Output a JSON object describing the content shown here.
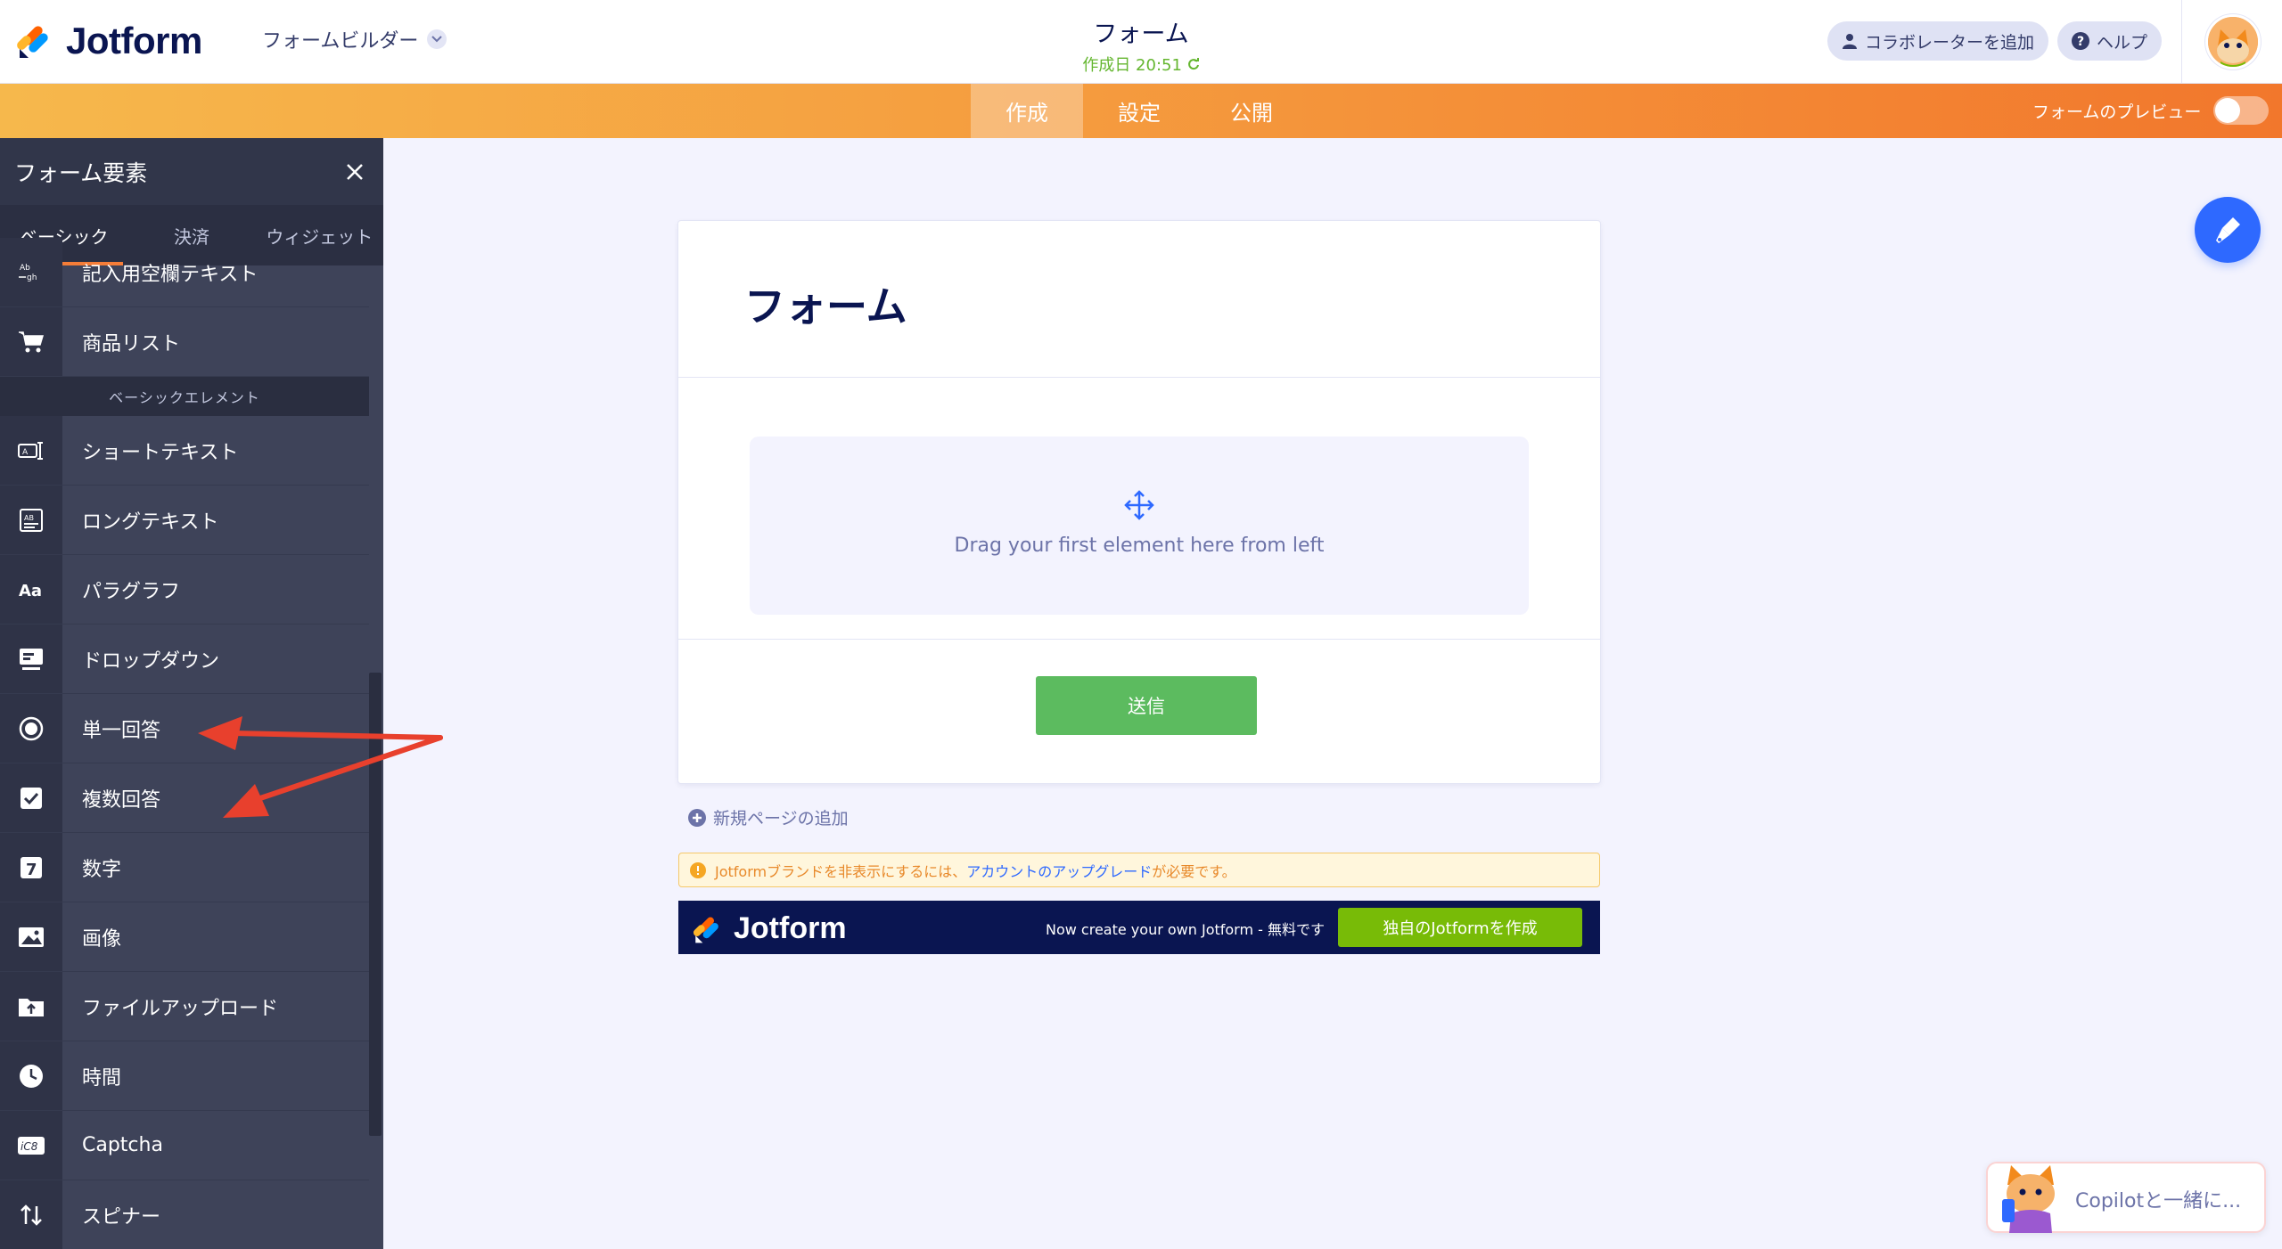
{
  "header": {
    "logo_text": "Jotform",
    "builder_label": "フォームビルダー",
    "form_title": "フォーム",
    "created_label": "作成日 20:51",
    "collab_button": "コラボレーターを追加",
    "help_button": "ヘルプ"
  },
  "nav": {
    "tabs": [
      {
        "label": "作成",
        "active": true
      },
      {
        "label": "設定",
        "active": false
      },
      {
        "label": "公開",
        "active": false
      }
    ],
    "preview_label": "フォームのプレビュー"
  },
  "sidebar": {
    "title": "フォーム要素",
    "tabs": [
      "ベーシック",
      "決済",
      "ウィジェット"
    ],
    "top_items": [
      {
        "label": "記入用空欄テキスト",
        "icon": "fill-blank-icon"
      },
      {
        "label": "商品リスト",
        "icon": "cart-icon"
      }
    ],
    "section_label": "ベーシックエレメント",
    "items": [
      {
        "label": "ショートテキスト",
        "icon": "short-text-icon"
      },
      {
        "label": "ロングテキスト",
        "icon": "long-text-icon"
      },
      {
        "label": "パラグラフ",
        "icon": "paragraph-icon"
      },
      {
        "label": "ドロップダウン",
        "icon": "dropdown-icon"
      },
      {
        "label": "単一回答",
        "icon": "radio-icon"
      },
      {
        "label": "複数回答",
        "icon": "checkbox-icon"
      },
      {
        "label": "数字",
        "icon": "number-icon"
      },
      {
        "label": "画像",
        "icon": "image-icon"
      },
      {
        "label": "ファイルアップロード",
        "icon": "upload-icon"
      },
      {
        "label": "時間",
        "icon": "clock-icon"
      },
      {
        "label": "Captcha",
        "icon": "captcha-icon"
      },
      {
        "label": "スピナー",
        "icon": "spinner-icon"
      }
    ]
  },
  "form": {
    "heading": "フォーム",
    "drop_hint": "Drag your first element here from left",
    "submit_label": "送信",
    "add_page_label": "新規ページの追加"
  },
  "notice": {
    "text_before": "Jotformブランドを非表示にするには、",
    "link_text": "アカウントのアップグレード",
    "text_after": "が必要です。"
  },
  "banner": {
    "logo_text": "Jotform",
    "text": "Now create your own Jotform - 無料です",
    "button": "独自のJotformを作成"
  },
  "copilot": {
    "label": "Copilotと一緒に..."
  },
  "colors": {
    "accent_orange": "#f59d3f",
    "submit_green": "#5cbb5f",
    "blue": "#2e69ff",
    "sidebar_bg": "#3e4359",
    "arrow_red": "#e8402d"
  }
}
